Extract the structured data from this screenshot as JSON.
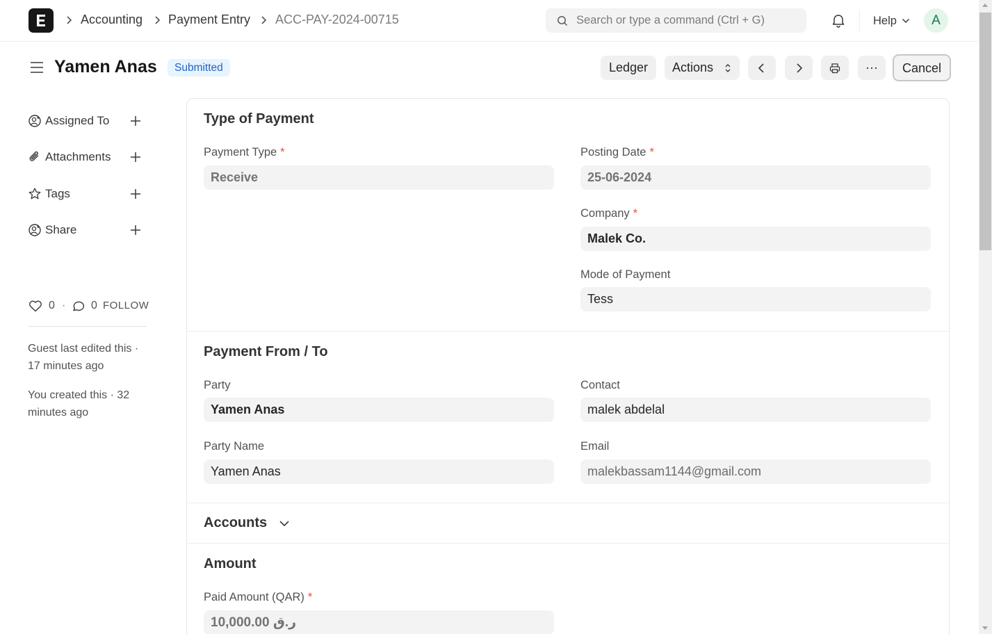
{
  "navbar": {
    "logo_letter": "E",
    "breadcrumbs": [
      "Accounting",
      "Payment Entry",
      "ACC-PAY-2024-00715"
    ],
    "search_placeholder": "Search or type a command (Ctrl + G)",
    "help_label": "Help",
    "avatar_initial": "A"
  },
  "page": {
    "title": "Yamen Anas",
    "status": "Submitted",
    "buttons": {
      "ledger": "Ledger",
      "actions": "Actions",
      "more": "···",
      "cancel": "Cancel"
    }
  },
  "sidebar": {
    "items": [
      {
        "label": "Assigned To",
        "icon": "assign-user-icon"
      },
      {
        "label": "Attachments",
        "icon": "paperclip-icon"
      },
      {
        "label": "Tags",
        "icon": "star-icon"
      },
      {
        "label": "Share",
        "icon": "share-user-icon"
      }
    ],
    "likes": "0",
    "separator": "·",
    "comments": "0",
    "follow_label": "FOLLOW",
    "edited_note": "Guest last edited this · 17 minutes ago",
    "created_note": "You created this · 32 minutes ago"
  },
  "form": {
    "type_of_payment": {
      "title": "Type of Payment",
      "payment_type_label": "Payment Type",
      "payment_type_value": "Receive",
      "posting_date_label": "Posting Date",
      "posting_date_value": "25-06-2024",
      "company_label": "Company",
      "company_value": "Malek Co.",
      "mode_label": "Mode of Payment",
      "mode_value": "Tess"
    },
    "payment_from_to": {
      "title": "Payment From / To",
      "party_label": "Party",
      "party_value": "Yamen Anas",
      "contact_label": "Contact",
      "contact_value": "malek abdelal",
      "party_name_label": "Party Name",
      "party_name_value": "Yamen Anas",
      "email_label": "Email",
      "email_value": "malekbassam1144@gmail.com"
    },
    "accounts": {
      "title": "Accounts"
    },
    "amount": {
      "title": "Amount",
      "paid_amount_label": "Paid Amount (QAR)",
      "paid_amount_value": "10,000.00 ر.ق"
    },
    "required_mark": "*"
  }
}
